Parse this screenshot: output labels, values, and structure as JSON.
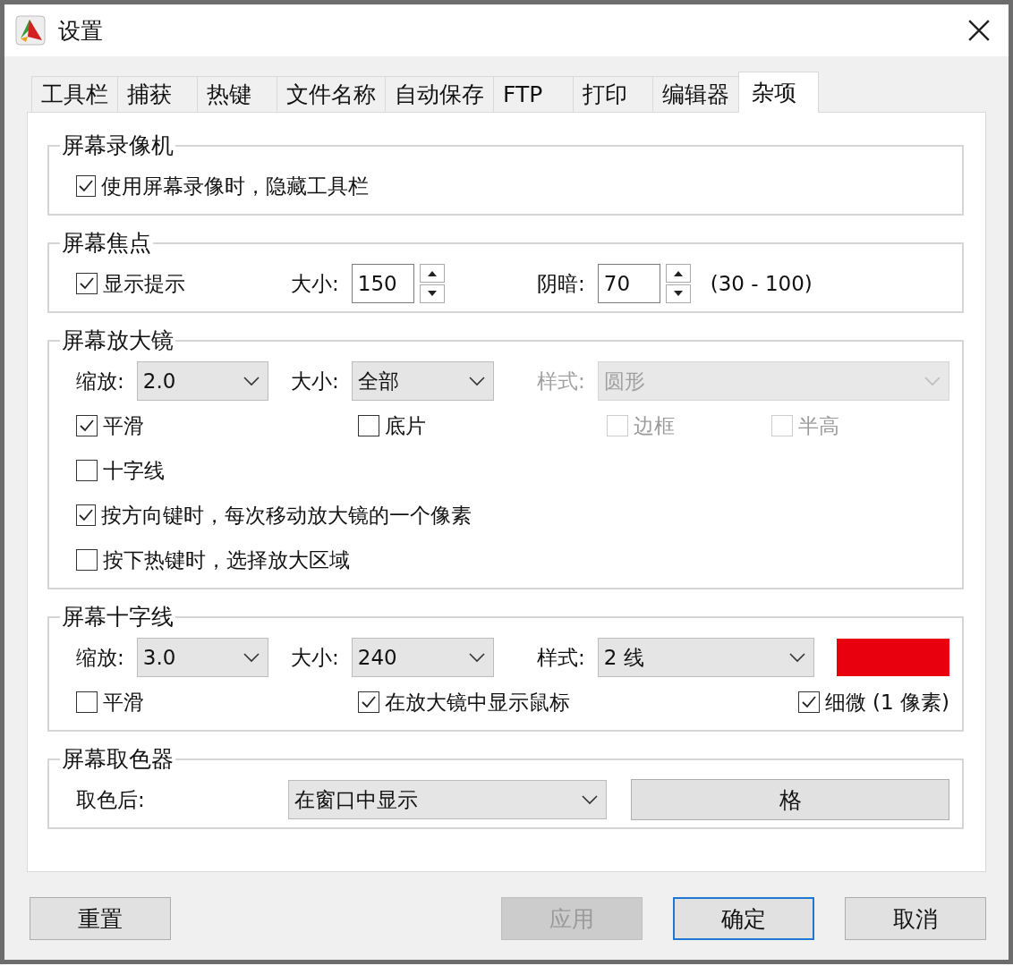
{
  "window": {
    "title": "设置"
  },
  "tabs": [
    {
      "label": "工具栏",
      "selected": false
    },
    {
      "label": "捕获",
      "selected": false
    },
    {
      "label": "热键",
      "selected": false
    },
    {
      "label": "文件名称",
      "selected": false
    },
    {
      "label": "自动保存",
      "selected": false
    },
    {
      "label": "FTP",
      "selected": false
    },
    {
      "label": "打印",
      "selected": false
    },
    {
      "label": "编辑器",
      "selected": false
    },
    {
      "label": "杂项",
      "selected": true
    }
  ],
  "groups": [
    {
      "title": "屏幕录像机",
      "rows": [
        {
          "kind": "checks",
          "items": [
            {
              "kind": "checkbox",
              "label": "使用屏幕录像时，隐藏工具栏",
              "checked": true,
              "disabled": false
            }
          ]
        }
      ]
    },
    {
      "title": "屏幕焦点",
      "rows": [
        {
          "kind": "fields",
          "items": [
            {
              "kind": "checkbox",
              "label": "显示提示",
              "checked": true,
              "disabled": false
            },
            {
              "kind": "spin",
              "label": "大小:",
              "value": "150"
            },
            {
              "kind": "spin",
              "label": "阴暗:",
              "value": "70"
            },
            {
              "kind": "text",
              "label": "(30 - 100)"
            }
          ]
        }
      ]
    },
    {
      "title": "屏幕放大镜",
      "rows": [
        {
          "kind": "fields",
          "items": [
            {
              "kind": "dropdown",
              "label": "缩放:",
              "value": "2.0",
              "disabled": false
            },
            {
              "kind": "dropdown",
              "label": "大小:",
              "value": "全部",
              "disabled": false
            },
            {
              "kind": "dropdown",
              "label": "样式:",
              "value": "圆形",
              "disabled": true
            }
          ]
        },
        {
          "kind": "checks",
          "items": [
            {
              "kind": "checkbox",
              "label": "平滑",
              "checked": true,
              "disabled": false
            },
            {
              "kind": "checkbox",
              "label": "底片",
              "checked": false,
              "disabled": false
            },
            {
              "kind": "checkbox",
              "label": "边框",
              "checked": false,
              "disabled": true
            },
            {
              "kind": "checkbox",
              "label": "半高",
              "checked": false,
              "disabled": true
            }
          ]
        },
        {
          "kind": "checks",
          "items": [
            {
              "kind": "checkbox",
              "label": "十字线",
              "checked": false,
              "disabled": false
            }
          ]
        },
        {
          "kind": "checks",
          "items": [
            {
              "kind": "checkbox",
              "label": "按方向键时，每次移动放大镜的一个像素",
              "checked": true,
              "disabled": false
            }
          ]
        },
        {
          "kind": "checks",
          "items": [
            {
              "kind": "checkbox",
              "label": "按下热键时，选择放大区域",
              "checked": false,
              "disabled": false
            }
          ]
        }
      ]
    },
    {
      "title": "屏幕十字线",
      "rows": [
        {
          "kind": "fields",
          "items": [
            {
              "kind": "dropdown",
              "label": "缩放:",
              "value": "3.0",
              "disabled": false
            },
            {
              "kind": "dropdown",
              "label": "大小:",
              "value": "240",
              "disabled": false
            },
            {
              "kind": "dropdown",
              "label": "样式:",
              "value": "2 线",
              "disabled": false
            },
            {
              "kind": "color",
              "color": "#e8000f"
            }
          ]
        },
        {
          "kind": "spread",
          "items": [
            {
              "kind": "checkbox",
              "label": "平滑",
              "checked": false,
              "disabled": false
            },
            {
              "kind": "checkbox",
              "label": "在放大镜中显示鼠标",
              "checked": true,
              "disabled": false
            },
            {
              "kind": "checkbox",
              "label": "细微 (1 像素)",
              "checked": true,
              "disabled": false
            }
          ]
        }
      ]
    },
    {
      "title": "屏幕取色器",
      "rows": [
        {
          "kind": "picker",
          "items": [
            {
              "kind": "text",
              "label": "取色后:"
            },
            {
              "kind": "dropdown",
              "value": "在窗口中显示",
              "disabled": false
            },
            {
              "kind": "button",
              "label": "格"
            }
          ]
        }
      ]
    }
  ],
  "buttons": [
    {
      "label": "重置",
      "disabled": false,
      "default": false
    },
    {
      "label": "应用",
      "disabled": true,
      "default": false
    },
    {
      "label": "确定",
      "disabled": false,
      "default": true
    },
    {
      "label": "取消",
      "disabled": false,
      "default": false
    }
  ]
}
